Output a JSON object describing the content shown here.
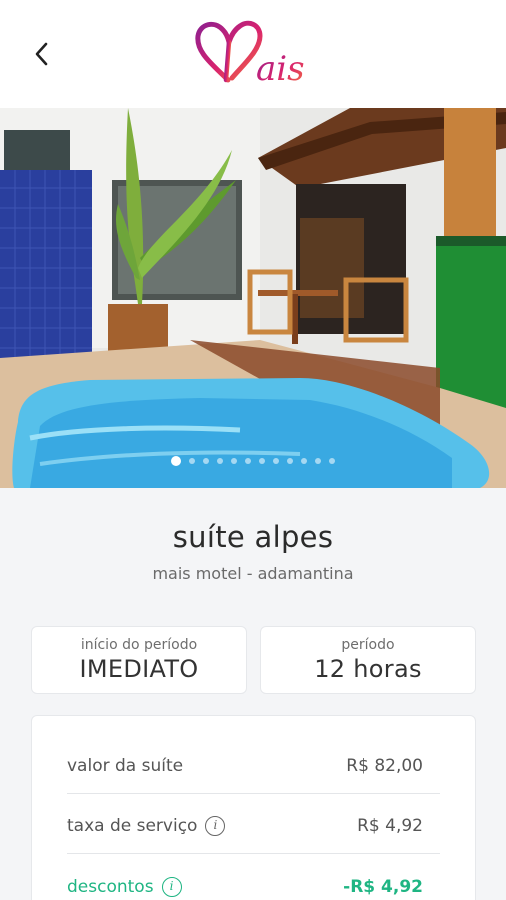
{
  "header": {
    "back_icon": "chevron-left-icon",
    "logo_text": "Mais"
  },
  "gallery": {
    "slide_count": 12,
    "active_index": 0
  },
  "suite": {
    "name": "suíte alpes",
    "motel": "mais motel - adamantina"
  },
  "period": {
    "start_label": "início do período",
    "start_value": "IMEDIATO",
    "duration_label": "período",
    "duration_value": "12 horas"
  },
  "prices": {
    "suite_label": "valor da suíte",
    "suite_value": "R$ 82,00",
    "service_label": "taxa de serviço",
    "service_value": "R$ 4,92",
    "discount_label": "descontos",
    "discount_value": "-R$ 4,92"
  },
  "colors": {
    "discount": "#1fb583",
    "logo_gradient_start": "#a21f8a",
    "logo_gradient_end": "#f0593a"
  }
}
